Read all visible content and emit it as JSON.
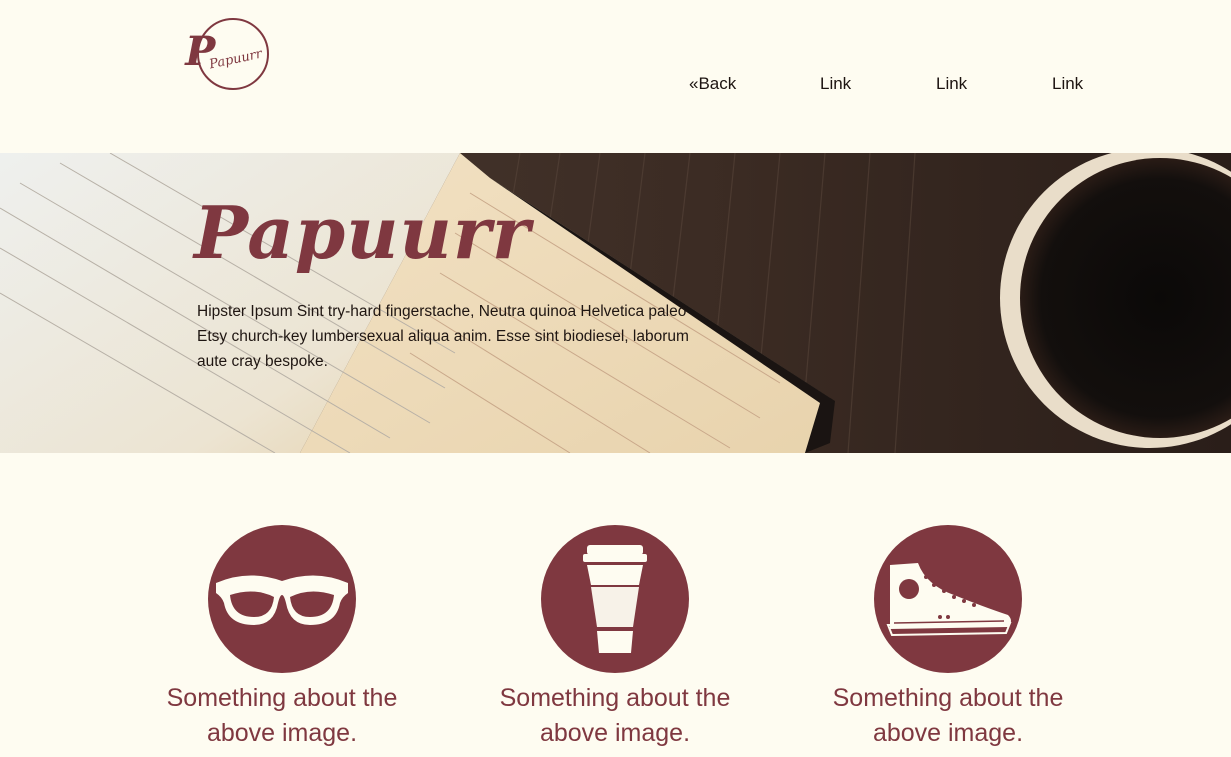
{
  "header": {
    "logo_text": "Papuurr",
    "nav": [
      {
        "label": "«Back"
      },
      {
        "label": "Link"
      },
      {
        "label": "Link"
      },
      {
        "label": "Link"
      }
    ]
  },
  "hero": {
    "title": "Papuurr",
    "text": "Hipster Ipsum Sint try-hard fingerstache, Neutra quinoa Helvetica paleo Etsy church-key lumbersexual aliqua anim. Esse sint biodiesel, laborum aute cray bespoke."
  },
  "features": [
    {
      "icon": "glasses-icon",
      "caption": "Something about the above image."
    },
    {
      "icon": "coffee-cup-icon",
      "caption": "Something about the above image."
    },
    {
      "icon": "sneaker-icon",
      "caption": "Something about the above image."
    }
  ],
  "colors": {
    "background": "#fefcf1",
    "accent": "#7f3840",
    "text": "#1d1411"
  }
}
